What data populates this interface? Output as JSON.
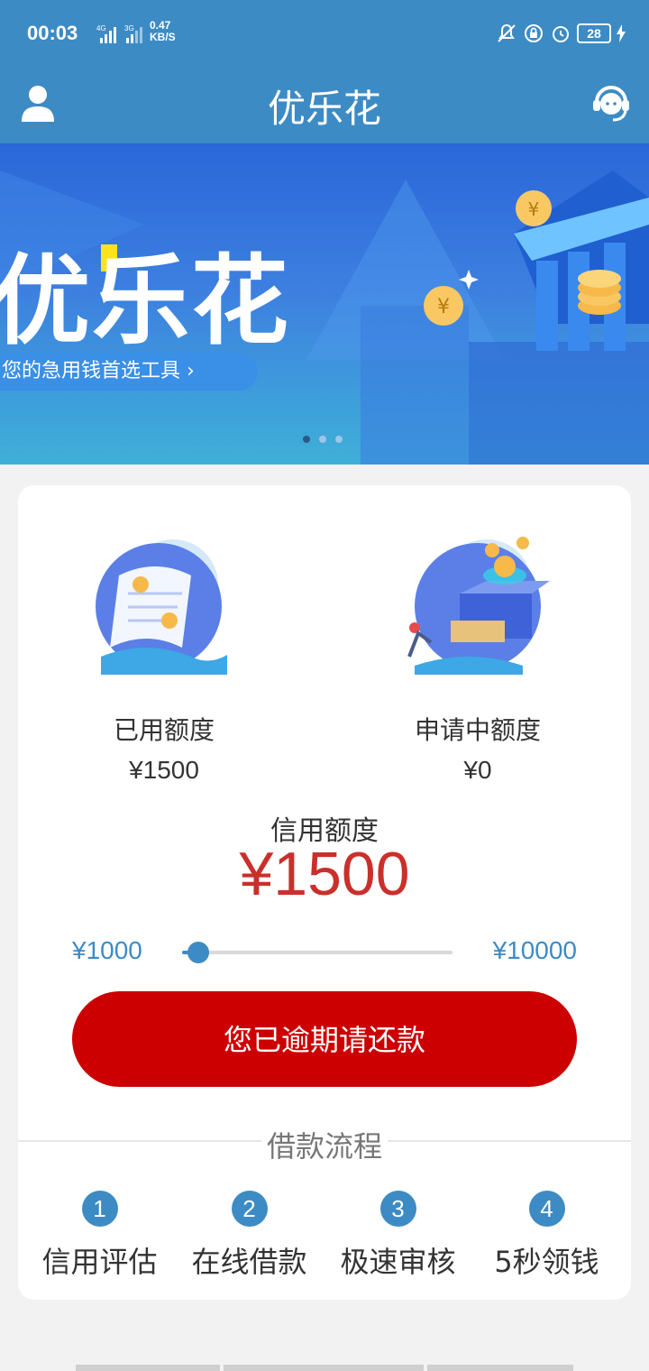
{
  "status_bar": {
    "time": "00:03",
    "network1": "4G",
    "network2": "3G",
    "speed_value": "0.47",
    "speed_unit": "KB/S",
    "battery": "28"
  },
  "header": {
    "title": "优乐花",
    "left_icon": "user-icon",
    "right_icon": "customer-service-icon"
  },
  "banner": {
    "title": "优乐花",
    "slogan": "您的急用钱首选工具 ›",
    "dots": [
      true,
      false,
      false
    ]
  },
  "quota": {
    "used_label": "已用额度",
    "used_value": "¥1500",
    "pending_label": "申请中额度",
    "pending_value": "¥0"
  },
  "credit": {
    "label": "信用额度",
    "value": "¥1500",
    "slider_min": "¥1000",
    "slider_max": "¥10000",
    "slider_fraction": 0.06
  },
  "repay_button": "您已逾期请还款",
  "process": {
    "title": "借款流程",
    "steps": [
      {
        "num": "1",
        "label": "信用评估"
      },
      {
        "num": "2",
        "label": "在线借款"
      },
      {
        "num": "3",
        "label": "极速审核"
      },
      {
        "num": "4",
        "label": "5秒领钱"
      }
    ]
  },
  "colors": {
    "primary": "#3d8bc4",
    "danger": "#cc0000",
    "credit_text": "#c9302c"
  }
}
